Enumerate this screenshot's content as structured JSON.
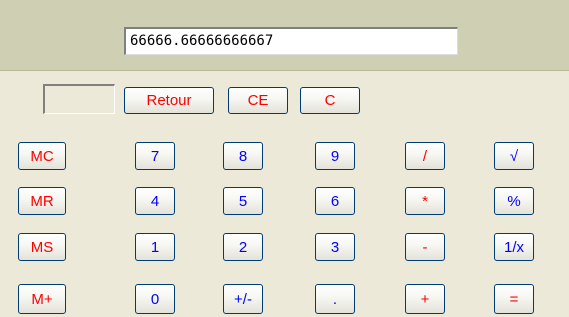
{
  "display": {
    "value": "66666.66666666667"
  },
  "top_row": [
    {
      "id": "retour",
      "label": "Retour"
    },
    {
      "id": "ce",
      "label": "CE"
    },
    {
      "id": "c",
      "label": "C"
    }
  ],
  "keys": {
    "mc": "MC",
    "mr": "MR",
    "ms": "MS",
    "mplus": "M+",
    "d7": "7",
    "d8": "8",
    "d9": "9",
    "div": "/",
    "sqrt": "√",
    "d4": "4",
    "d5": "5",
    "d6": "6",
    "mul": "*",
    "pct": "%",
    "d1": "1",
    "d2": "2",
    "d3": "3",
    "sub": "-",
    "inv": "1/x",
    "d0": "0",
    "sign": "+/-",
    "dot": ".",
    "add": "+",
    "eq": "="
  }
}
